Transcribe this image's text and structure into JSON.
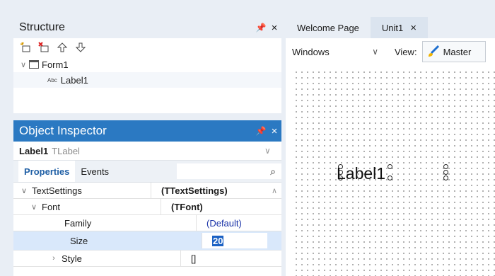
{
  "structure": {
    "title": "Structure",
    "pin": "↑",
    "close": "×",
    "toolbar": {
      "icons": [
        "add-component-icon",
        "delete-component-icon",
        "move-up-icon",
        "move-down-icon"
      ]
    },
    "tree": [
      {
        "label": "Form1",
        "icon": "form-icon",
        "expanded": true
      },
      {
        "label": "Label1",
        "icon": "abc-icon",
        "icon_text": "Abc"
      }
    ]
  },
  "inspector": {
    "title": "Object Inspector",
    "pin": "↑",
    "close": "×",
    "selected": {
      "name": "Label1",
      "type": "TLabel"
    },
    "tabs": [
      {
        "label": "Properties",
        "active": true
      },
      {
        "label": "Events",
        "active": false
      }
    ],
    "properties": [
      {
        "name": "TextSettings",
        "value": "(TTextSettings)",
        "expanded": true
      },
      {
        "name": "Font",
        "value": "(TFont)",
        "expanded": true
      },
      {
        "name": "Family",
        "value": "(Default)"
      },
      {
        "name": "Size",
        "value": "20"
      },
      {
        "name": "Style",
        "value": "[]",
        "expanded": false
      }
    ]
  },
  "editor": {
    "tabs": [
      {
        "label": "Welcome Page",
        "active": false
      },
      {
        "label": "Unit1",
        "active": true,
        "close": "×"
      }
    ],
    "platform_combo": "Windows",
    "view_label": "View:",
    "view_value": "Master",
    "canvas_label": "Label1"
  },
  "colors": {
    "accent": "#2b79c2",
    "selection": "#1c62c4"
  }
}
